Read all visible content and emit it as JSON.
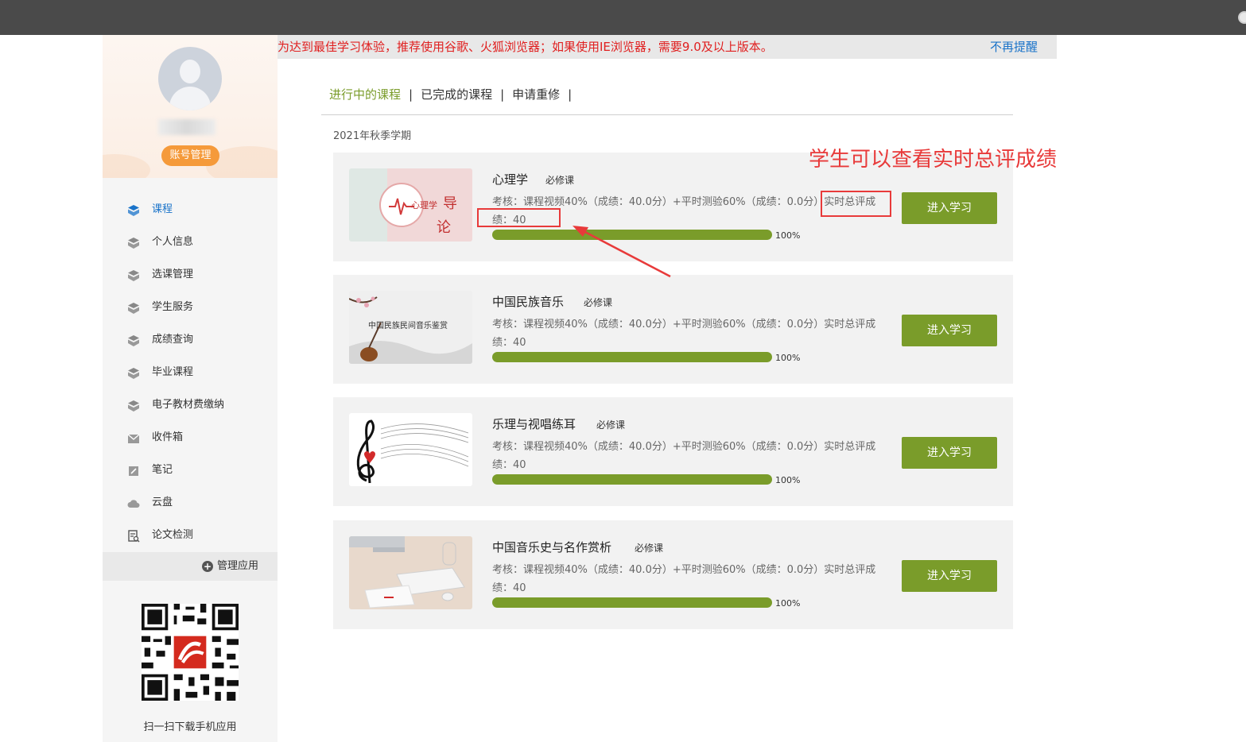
{
  "notice": {
    "text": "为达到最佳学习体验，推荐使用谷歌、火狐浏览器；如果使用IE浏览器，需要9.0及以上版本。",
    "close_label": "不再提醒"
  },
  "sidebar": {
    "account_button": "账号管理",
    "items": [
      {
        "label": "课程",
        "icon": "cube-icon",
        "active": true
      },
      {
        "label": "个人信息",
        "icon": "cube-icon"
      },
      {
        "label": "选课管理",
        "icon": "cube-icon"
      },
      {
        "label": "学生服务",
        "icon": "cube-icon"
      },
      {
        "label": "成绩查询",
        "icon": "cube-icon"
      },
      {
        "label": "毕业课程",
        "icon": "cube-icon"
      },
      {
        "label": "电子教材费缴纳",
        "icon": "cube-icon"
      },
      {
        "label": "收件箱",
        "icon": "inbox-icon"
      },
      {
        "label": "笔记",
        "icon": "note-icon"
      },
      {
        "label": "云盘",
        "icon": "cloud-icon"
      },
      {
        "label": "论文检测",
        "icon": "document-search-icon"
      }
    ],
    "manage_apps": "管理应用",
    "qr_caption": "扫一扫下载手机应用"
  },
  "tabs": {
    "items": [
      "进行中的课程",
      "已完成的课程",
      "申请重修"
    ],
    "separator": "|"
  },
  "semester": "2021年秋季学期",
  "courses": [
    {
      "name": "心理学",
      "tag": "必修课",
      "desc": "考核：课程视频40%（成绩：40.0分）+平时测验60%（成绩：0.0分）实时总评成绩：40",
      "progress": 1.0,
      "progress_label": "100%",
      "button": "进入学习"
    },
    {
      "name": "中国民族音乐",
      "tag": "必修课",
      "desc": "考核：课程视频40%（成绩：40.0分）+平时测验60%（成绩：0.0分）实时总评成绩：40",
      "progress": 1.0,
      "progress_label": "100%",
      "button": "进入学习"
    },
    {
      "name": "乐理与视唱练耳",
      "tag": "必修课",
      "desc": "考核：课程视频40%（成绩：40.0分）+平时测验60%（成绩：0.0分）实时总评成绩：40",
      "progress": 1.0,
      "progress_label": "100%",
      "button": "进入学习"
    },
    {
      "name": "中国音乐史与名作赏析",
      "tag": "必修课",
      "desc": "考核：课程视频40%（成绩：40.0分）+平时测验60%（成绩：0.0分）实时总评成绩：40",
      "progress": 1.0,
      "progress_label": "100%",
      "button": "进入学习"
    }
  ],
  "annotation": {
    "text": "学生可以查看实时总评成绩"
  },
  "colors": {
    "accent_green": "#7a9c2a",
    "notice_red": "#e02020",
    "link_blue": "#1a73c9",
    "annotation_red": "#e83a3a",
    "account_orange": "#f59a3a"
  }
}
